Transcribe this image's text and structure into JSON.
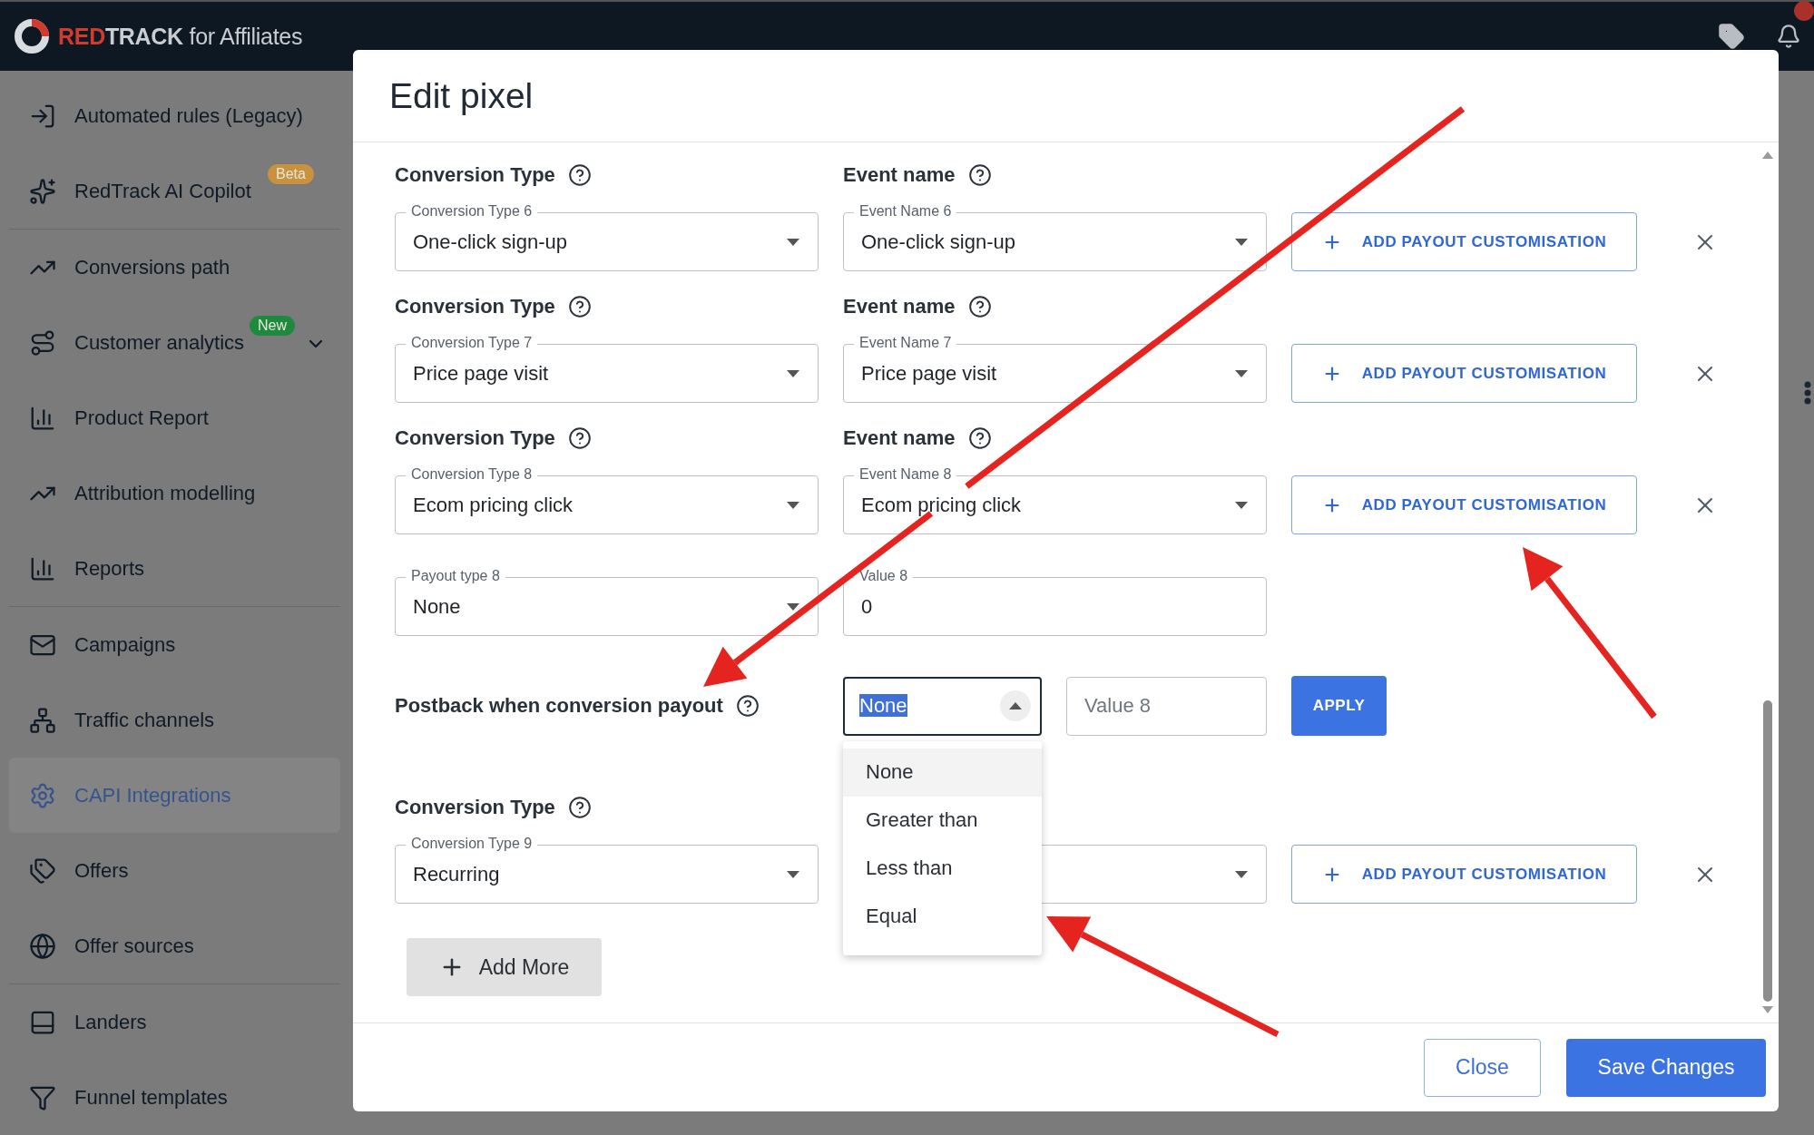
{
  "topbar": {
    "logo": {
      "brand_a": "RED",
      "brand_b": "TRACK",
      "suffix": "for Affiliates"
    },
    "notifications": {
      "unread": true
    }
  },
  "sidebar": {
    "groups": [
      [
        {
          "label": "Automated rules (Legacy)",
          "selected": false,
          "expandable": false
        },
        {
          "label": "RedTrack AI Copilot",
          "selected": false,
          "expandable": false,
          "badge": {
            "text": "Beta",
            "color": "#c8923e"
          }
        }
      ],
      [
        {
          "label": "Conversions path",
          "selected": false,
          "expandable": false
        },
        {
          "label": "Customer analytics",
          "selected": false,
          "expandable": true,
          "badge": {
            "text": "New",
            "color": "#1e8a3e"
          }
        },
        {
          "label": "Product Report",
          "selected": false,
          "expandable": false
        },
        {
          "label": "Attribution modelling",
          "selected": false,
          "expandable": false
        },
        {
          "label": "Reports",
          "selected": false,
          "expandable": false
        }
      ],
      [
        {
          "label": "Campaigns",
          "selected": false,
          "expandable": false
        },
        {
          "label": "Traffic channels",
          "selected": false,
          "expandable": false
        },
        {
          "label": "CAPI Integrations",
          "selected": true,
          "expandable": false
        },
        {
          "label": "Offers",
          "selected": false,
          "expandable": false
        },
        {
          "label": "Offer sources",
          "selected": false,
          "expandable": false
        }
      ],
      [
        {
          "label": "Landers",
          "selected": false,
          "expandable": false
        },
        {
          "label": "Funnel templates",
          "selected": false,
          "expandable": false
        }
      ]
    ]
  },
  "modal": {
    "title": "Edit pixel",
    "sections": [
      {
        "kind": "conversion",
        "type_heading": "Conversion Type",
        "event_heading": "Event name",
        "type_field": {
          "label": "Conversion Type 6",
          "value": "One-click sign-up"
        },
        "event_field": {
          "label": "Event Name 6",
          "value": "One-click sign-up"
        },
        "payout_button": "ADD PAYOUT CUSTOMISATION"
      },
      {
        "kind": "conversion",
        "type_heading": "Conversion Type",
        "event_heading": "Event name",
        "type_field": {
          "label": "Conversion Type 7",
          "value": "Price page visit"
        },
        "event_field": {
          "label": "Event Name 7",
          "value": "Price page visit"
        },
        "payout_button": "ADD PAYOUT CUSTOMISATION"
      },
      {
        "kind": "conversion",
        "type_heading": "Conversion Type",
        "event_heading": "Event name",
        "type_field": {
          "label": "Conversion Type 8",
          "value": "Ecom pricing click"
        },
        "event_field": {
          "label": "Event Name 8",
          "value": "Ecom pricing click"
        },
        "payout_button": "ADD PAYOUT CUSTOMISATION"
      },
      {
        "kind": "payout",
        "payout_type": {
          "label": "Payout type 8",
          "value": "None"
        },
        "value_field": {
          "label": "Value 8",
          "value": "0"
        }
      },
      {
        "kind": "postback",
        "label": "Postback when conversion payout",
        "operator": {
          "value": "None",
          "expanded": true,
          "options": [
            {
              "label": "None",
              "selected": true
            },
            {
              "label": "Greater than",
              "selected": false
            },
            {
              "label": "Less than",
              "selected": false
            },
            {
              "label": "Equal",
              "selected": false
            }
          ]
        },
        "value_placeholder": "Value 8",
        "apply": "APPLY"
      },
      {
        "kind": "conversion",
        "type_heading": "Conversion Type",
        "type_field": {
          "label": "Conversion Type 9",
          "value": "Recurring"
        },
        "payout_button": "ADD PAYOUT CUSTOMISATION"
      }
    ],
    "add_more": "Add More",
    "footer": {
      "close": "Close",
      "save": "Save Changes"
    }
  }
}
